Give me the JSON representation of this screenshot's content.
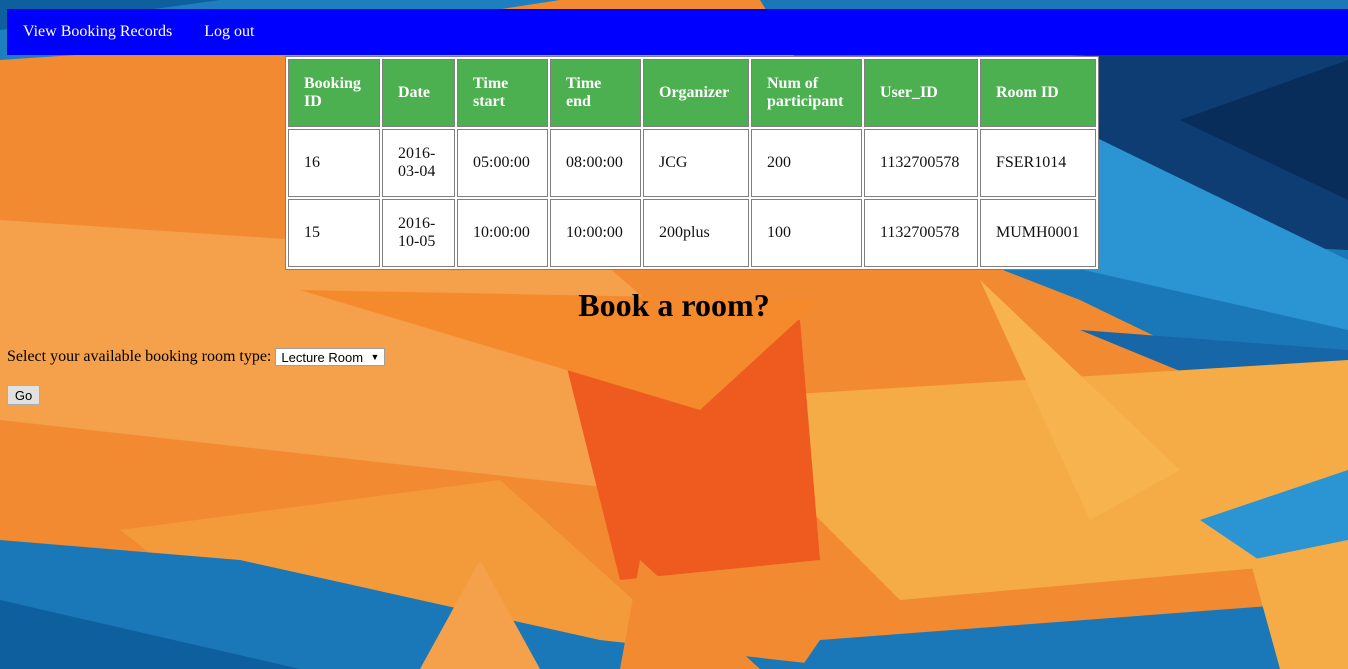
{
  "nav": {
    "view_records": "View Booking Records",
    "logout": "Log out"
  },
  "table": {
    "headers": [
      "Booking ID",
      "Date",
      "Time start",
      "Time end",
      "Organizer",
      "Num of participant",
      "User_ID",
      "Room ID"
    ],
    "rows": [
      [
        "16",
        "2016-03-04",
        "05:00:00",
        "08:00:00",
        "JCG",
        "200",
        "1132700578",
        "FSER1014"
      ],
      [
        "15",
        "2016-10-05",
        "10:00:00",
        "10:00:00",
        "200plus",
        "100",
        "1132700578",
        "MUMH0001"
      ]
    ]
  },
  "booking": {
    "title": "Book a room?",
    "select_label": "Select your available booking room type:",
    "select_value": "Lecture Room",
    "go_label": "Go"
  },
  "colors": {
    "nav_bg": "#0000ff",
    "header_bg": "#4caf50",
    "bg_orange": "#f28a32",
    "bg_blue": "#1a78b8"
  }
}
